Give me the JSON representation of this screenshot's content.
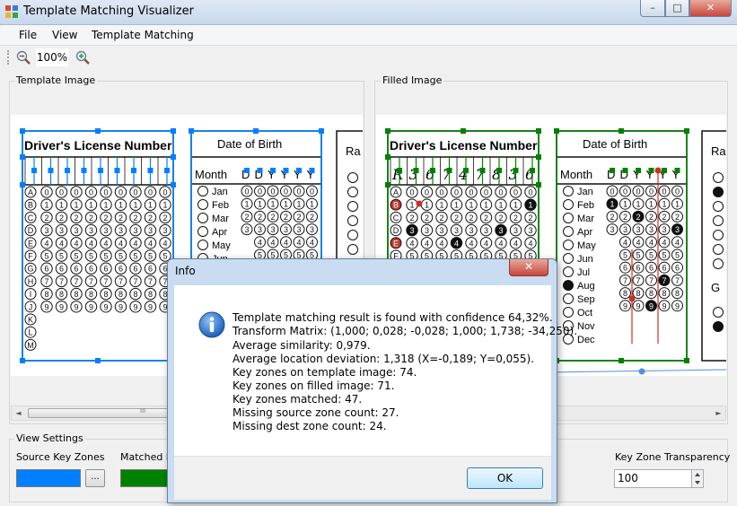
{
  "window": {
    "title": "Template Matching Visualizer",
    "minimize_glyph": "–",
    "maximize_glyph": "□",
    "close_glyph": "✕"
  },
  "menu": [
    "File",
    "View",
    "Template Matching"
  ],
  "toolbar": {
    "zoom_level": "100%"
  },
  "panels": {
    "template": {
      "label": "Template Image"
    },
    "filled": {
      "label": "Filled Image"
    }
  },
  "form": {
    "license_title": "Driver's License Number",
    "dob_title": "Date of Birth",
    "month_header": "Month",
    "dob_headers": [
      "D",
      "D",
      "Y",
      "Y",
      "Y",
      "Y"
    ],
    "months": [
      "Jan",
      "Feb",
      "Mar",
      "Apr",
      "May",
      "Jun",
      "Jul",
      "Aug",
      "Sep",
      "Oct",
      "Nov",
      "Dec"
    ],
    "letters": [
      "A",
      "B",
      "C",
      "D",
      "E",
      "F",
      "G",
      "H",
      "I",
      "J",
      "K",
      "L",
      "M"
    ],
    "digits": [
      "0",
      "1",
      "2",
      "3",
      "4",
      "5",
      "6",
      "7",
      "8",
      "9"
    ],
    "next_section_fragment": "Ra",
    "next_section_fragment_2": "G",
    "handwritten": [
      "R",
      "3",
      "6",
      "7",
      "4",
      "7",
      "8",
      "3",
      "6"
    ]
  },
  "scrollbar": {
    "left_arrow": "◄",
    "right_arrow": "►",
    "thumb_grip": "III"
  },
  "view_settings": {
    "label": "View Settings",
    "source_key_zones": "Source Key Zones",
    "matched_key": "Matched K",
    "browse_label": "...",
    "key_zone_transparency": "Key Zone Transparency",
    "transparency_value": "100",
    "source_color": "#0080ff",
    "matched_color": "#008000"
  },
  "dialog": {
    "title": "Info",
    "close_glyph": "✕",
    "icon": "info-icon",
    "lines": [
      "Template matching result is found with confidence 64,32%.",
      "Transform Matrix: (1,000; 0,028; -0,028; 1,000; 1,738; -34,250).",
      "Average similarity: 0,979.",
      "Average location deviation: 1,318 (X=-0,189; Y=0,055).",
      "Key zones on template image: 74.",
      "Key zones on filled image: 71.",
      "Key zones matched: 47.",
      "Missing source zone count: 27.",
      "Missing dest zone count: 24."
    ],
    "ok_label": "OK"
  }
}
